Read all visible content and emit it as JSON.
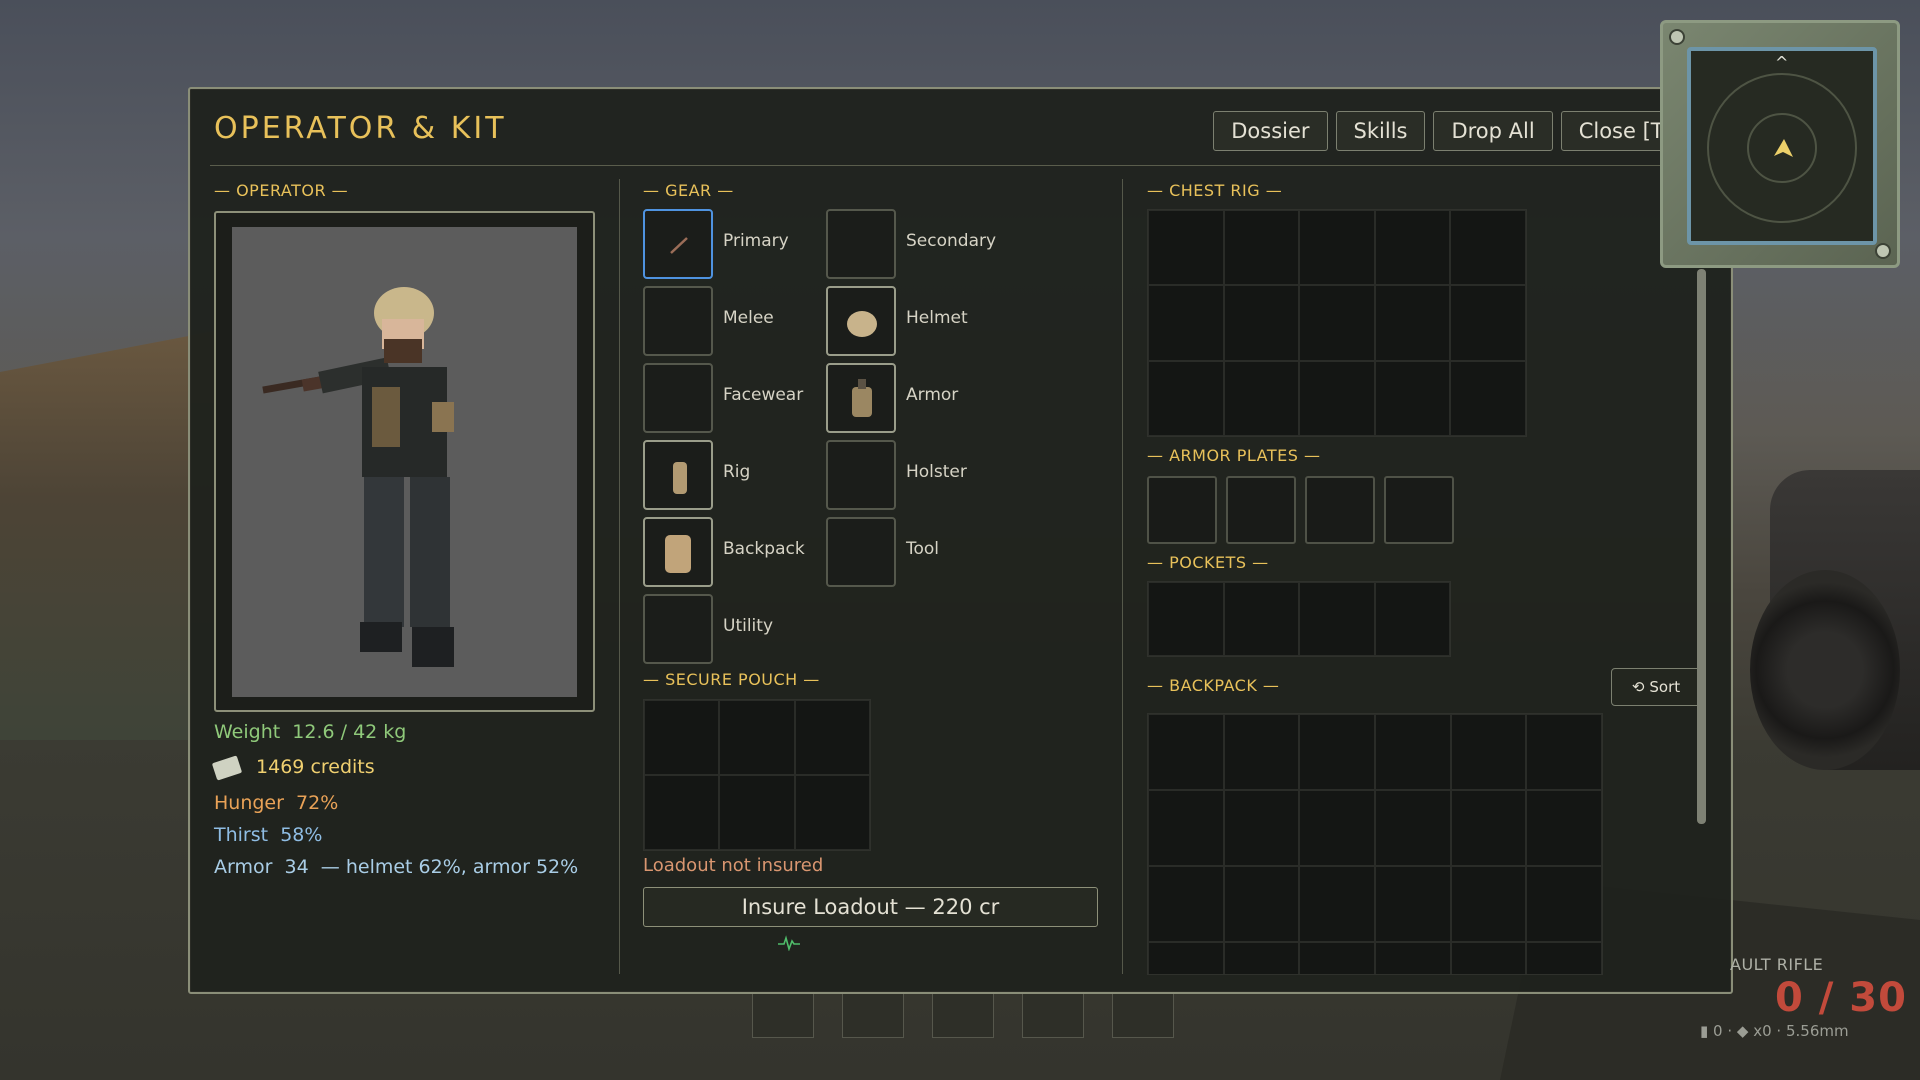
{
  "panel": {
    "title": "OPERATOR & KIT",
    "buttons": [
      "Dossier",
      "Skills",
      "Drop All",
      "Close [Ta"
    ]
  },
  "operator": {
    "section_title": "— OPERATOR —",
    "weight_label": "Weight",
    "weight_value": "12.6 / 42 kg",
    "credits": "1469 credits",
    "hunger_label": "Hunger",
    "hunger_value": "72%",
    "thirst_label": "Thirst",
    "thirst_value": "58%",
    "armor_label": "Armor",
    "armor_value": "34",
    "armor_detail": "— helmet 62%, armor 52%"
  },
  "gear": {
    "section_title": "— GEAR —",
    "slots": [
      "Primary",
      "Secondary",
      "Melee",
      "Helmet",
      "Facewear",
      "Armor",
      "Rig",
      "Holster",
      "Backpack",
      "Tool",
      "Utility"
    ]
  },
  "secure_pouch": {
    "section_title": "— SECURE POUCH —",
    "insure_note": "Loadout not insured",
    "insure_button": "Insure Loadout — 220 cr"
  },
  "chest_rig": {
    "section_title": "— CHEST RIG —"
  },
  "armor_plates": {
    "section_title": "— ARMOR PLATES —"
  },
  "pockets": {
    "section_title": "— POCKETS —"
  },
  "backpack": {
    "section_title": "— BACKPACK —",
    "sort_label": "Sort"
  },
  "minimap": {
    "north": "^"
  },
  "hud": {
    "weapon_name": "AULT RIFLE",
    "ammo": "0 / 30",
    "reserve": "0",
    "multiplier": "x0",
    "caliber": "5.56mm"
  },
  "colors": {
    "accent": "#e8c15a",
    "selected_slot": "#4f93e0",
    "ammo_empty": "#c24a3b"
  }
}
